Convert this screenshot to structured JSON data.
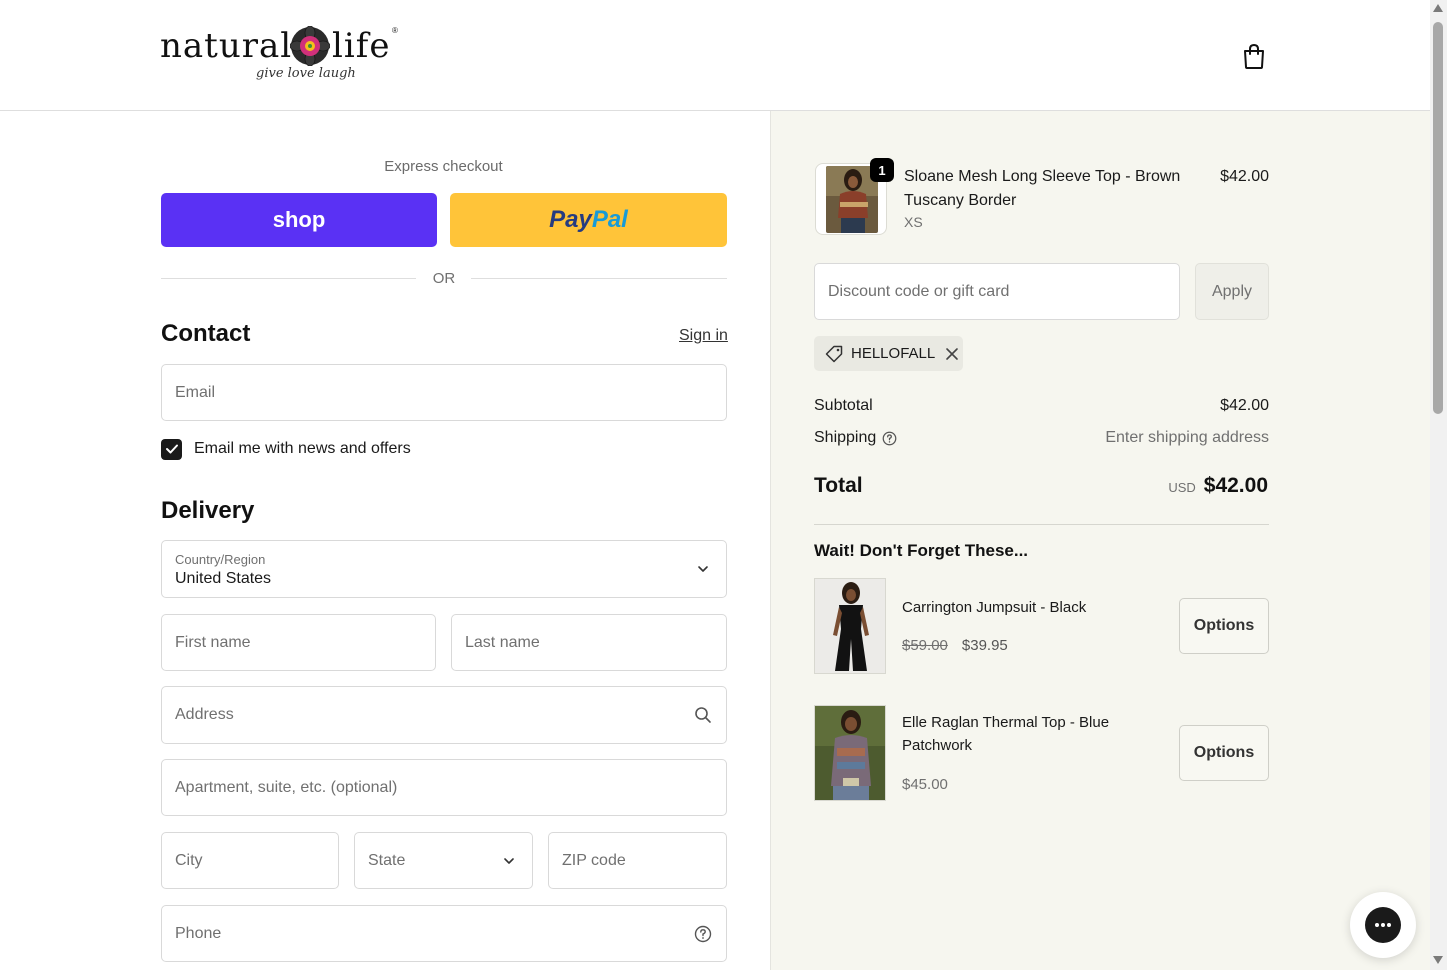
{
  "brand": {
    "logo_word_left": "natural",
    "logo_word_right": "life",
    "logo_tagline": "give love laugh",
    "logo_reg": "®",
    "cart_icon": "shopping-bag-icon"
  },
  "express": {
    "title": "Express checkout",
    "shop_label": "shop",
    "paypal_label_1": "Pay",
    "paypal_label_2": "Pal",
    "or_label": "OR"
  },
  "contact": {
    "heading": "Contact",
    "signin_label": "Sign in",
    "email_placeholder": "Email",
    "newsletter_label": "Email me with news and offers",
    "newsletter_checked": true
  },
  "delivery": {
    "heading": "Delivery",
    "country_label": "Country/Region",
    "country_value": "United States",
    "first_name_placeholder": "First name",
    "last_name_placeholder": "Last name",
    "address_placeholder": "Address",
    "apartment_placeholder": "Apartment, suite, etc. (optional)",
    "city_placeholder": "City",
    "state_placeholder": "State",
    "zip_placeholder": "ZIP code",
    "phone_placeholder": "Phone"
  },
  "order": {
    "item": {
      "name": "Sloane Mesh Long Sleeve Top - Brown Tuscany Border",
      "variant": "XS",
      "price": "$42.00",
      "quantity": "1"
    },
    "discount_placeholder": "Discount code or gift card",
    "apply_label": "Apply",
    "applied_code": "HELLOFALL",
    "subtotal_label": "Subtotal",
    "subtotal_value": "$42.00",
    "shipping_label": "Shipping",
    "shipping_value": "Enter shipping address",
    "total_label": "Total",
    "total_currency": "USD",
    "total_value": "$42.00"
  },
  "upsell": {
    "title": "Wait! Don't Forget These...",
    "items": [
      {
        "name": "Carrington Jumpsuit - Black",
        "compare_price": "$59.00",
        "price": "$39.95",
        "button": "Options"
      },
      {
        "name": "Elle Raglan Thermal Top - Blue Patchwork",
        "price": "$45.00",
        "button": "Options"
      }
    ]
  },
  "colors": {
    "shop_purple": "#5a31f4",
    "paypal_yellow": "#ffc439",
    "summary_bg": "#f6f6ef"
  }
}
